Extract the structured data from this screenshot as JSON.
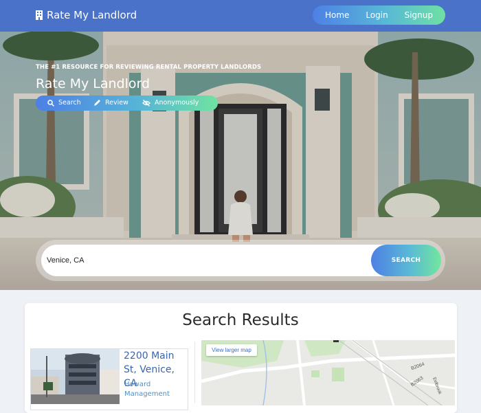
{
  "navbar": {
    "brand": "Rate My Landlord",
    "links": [
      "Home",
      "Login",
      "Signup"
    ]
  },
  "hero": {
    "subtitle": "THE #1 RESOURCE FOR REVIEWING RENTAL PROPERTY LANDLORDS",
    "title": "Rate My Landlord",
    "features": [
      "Search",
      "Review",
      "Anonymously"
    ]
  },
  "search": {
    "value": "Venice, CA",
    "button_label": "SEARCH"
  },
  "results": {
    "title": "Search Results",
    "items": [
      {
        "address": "2200 Main St, Venice, CA",
        "management": "Howard Management"
      }
    ],
    "map_button": "View larger map",
    "map_labels": [
      "B2064",
      "B2063",
      "Eelbrook"
    ]
  },
  "colors": {
    "navbar": "#4a72c9",
    "gradient_start": "#4d7fe4",
    "gradient_end": "#6fe3a0",
    "link_blue": "#3a64ad"
  }
}
